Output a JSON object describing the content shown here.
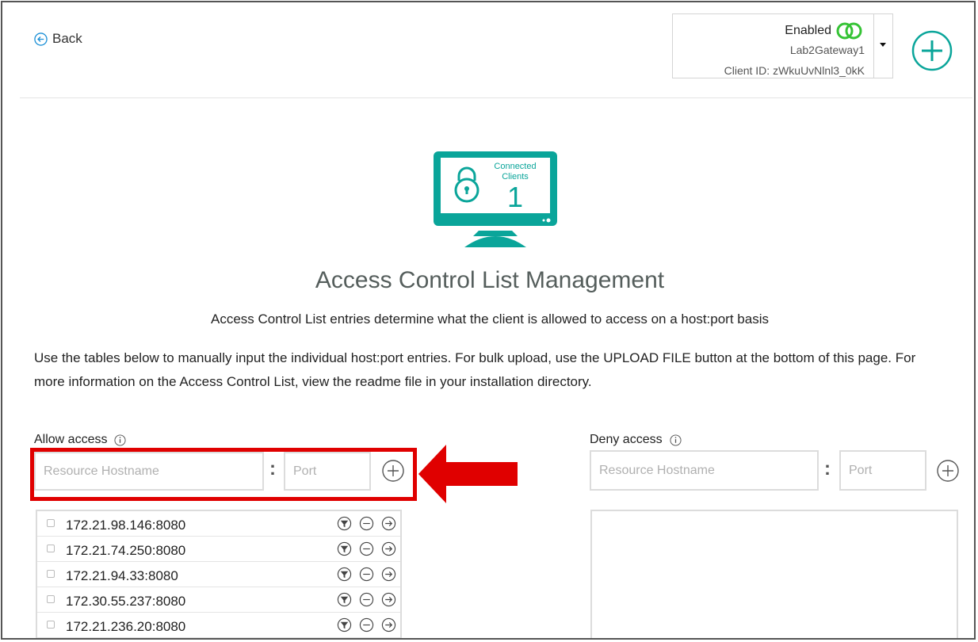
{
  "header": {
    "back_label": "Back",
    "client": {
      "status": "Enabled",
      "name": "Lab2Gateway1",
      "client_id": "Client ID: zWkuUvNlnl3_0kK"
    }
  },
  "hero": {
    "monitor_line1": "Connected",
    "monitor_line2": "Clients",
    "count": "1"
  },
  "title": "Access Control List Management",
  "subtitle": "Access Control List entries determine what the client is allowed to access on a host:port basis",
  "description": "Use the tables below to manually input the individual host:port entries. For bulk upload, use the UPLOAD FILE button at the bottom of this page. For more information on the Access Control List, view the readme file in your installation directory.",
  "allow": {
    "label": "Allow access",
    "hostname_placeholder": "Resource Hostname",
    "port_placeholder": "Port",
    "separator": ":",
    "entries": [
      "172.21.98.146:8080",
      "172.21.74.250:8080",
      "172.21.94.33:8080",
      "172.30.55.237:8080",
      "172.21.236.20:8080"
    ]
  },
  "deny": {
    "label": "Deny access",
    "hostname_placeholder": "Resource Hostname",
    "port_placeholder": "Port",
    "separator": ":",
    "entries": []
  },
  "colors": {
    "teal": "#0aa59a",
    "teal_light": "#2bb5aa",
    "status_green": "#35c335",
    "highlight_red": "#e00000",
    "border_gray": "#dcdcdc"
  },
  "icons": [
    "back-icon",
    "linked-rings-icon",
    "chevron-down-icon",
    "plus-circle-icon",
    "monitor-lock-icon",
    "info-icon",
    "filter-icon",
    "minus-circle-icon",
    "arrow-right-circle-icon"
  ]
}
